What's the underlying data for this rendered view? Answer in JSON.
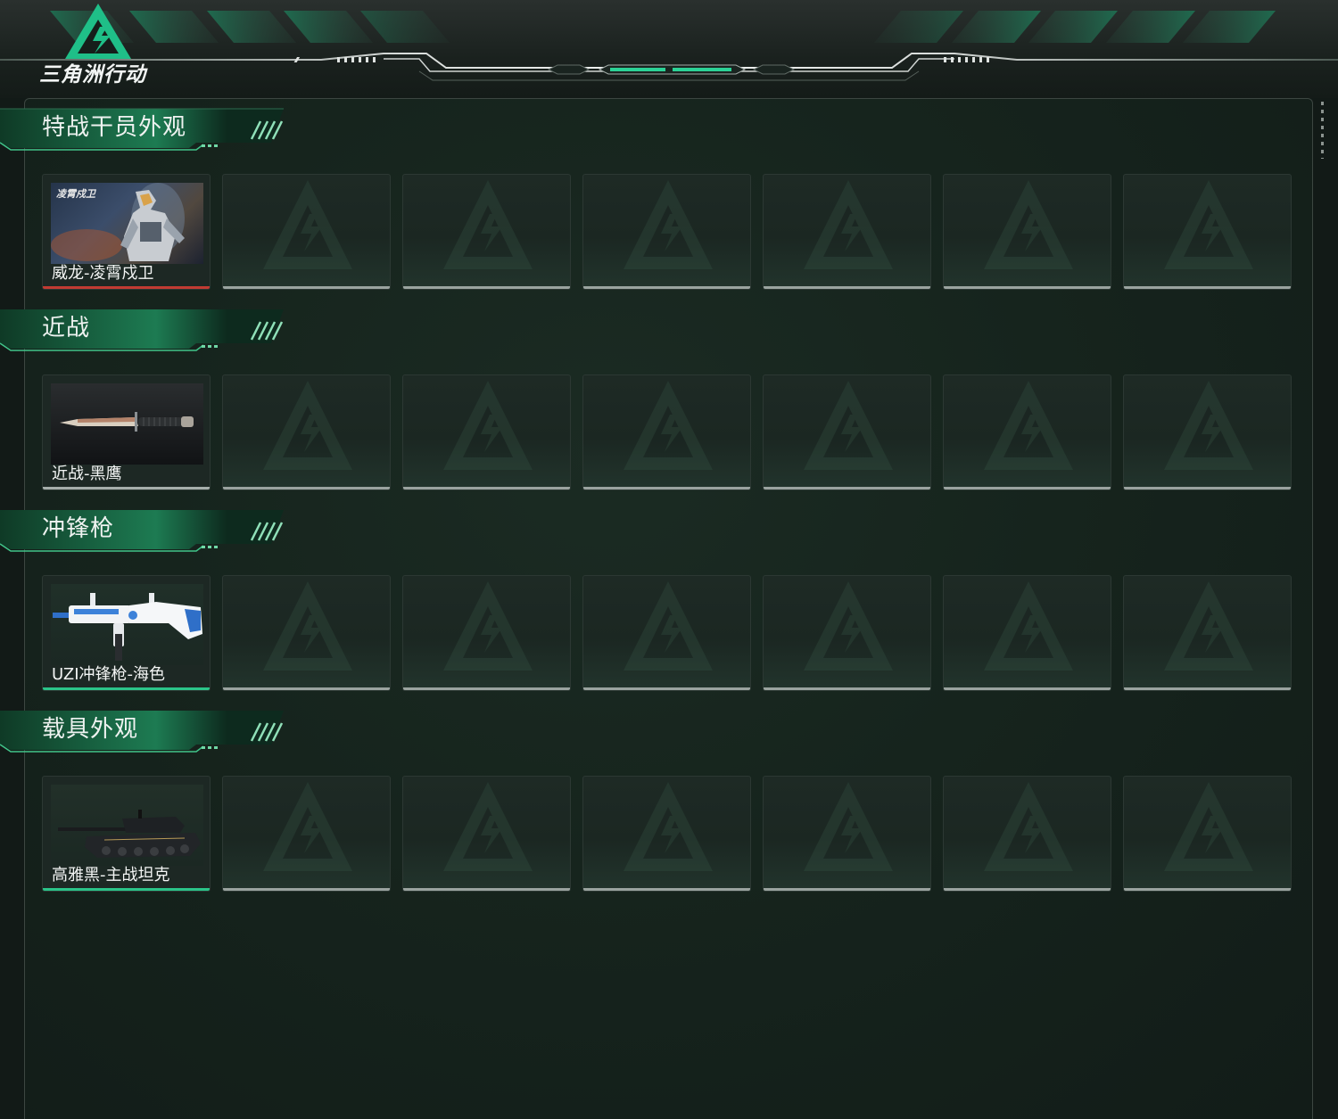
{
  "app": {
    "logo_text": "三角洲行动",
    "accent_color": "#22c08a"
  },
  "sections": [
    {
      "title": "特战干员外观",
      "items": [
        {
          "name": "威龙-凌霄戍卫",
          "rarity_color": "#c23b33",
          "thumb_label": "凌霄戍卫"
        }
      ],
      "empty_slots": 6
    },
    {
      "title": "近战",
      "items": [
        {
          "name": "近战-黑鹰",
          "rarity_color": "#a6aeab"
        }
      ],
      "empty_slots": 6
    },
    {
      "title": "冲锋枪",
      "items": [
        {
          "name": "UZI冲锋枪-海色",
          "rarity_color": "#2bc489"
        }
      ],
      "empty_slots": 6
    },
    {
      "title": "载具外观",
      "items": [
        {
          "name": "高雅黑-主战坦克",
          "rarity_color": "#2bc489"
        }
      ],
      "empty_slots": 6
    }
  ]
}
